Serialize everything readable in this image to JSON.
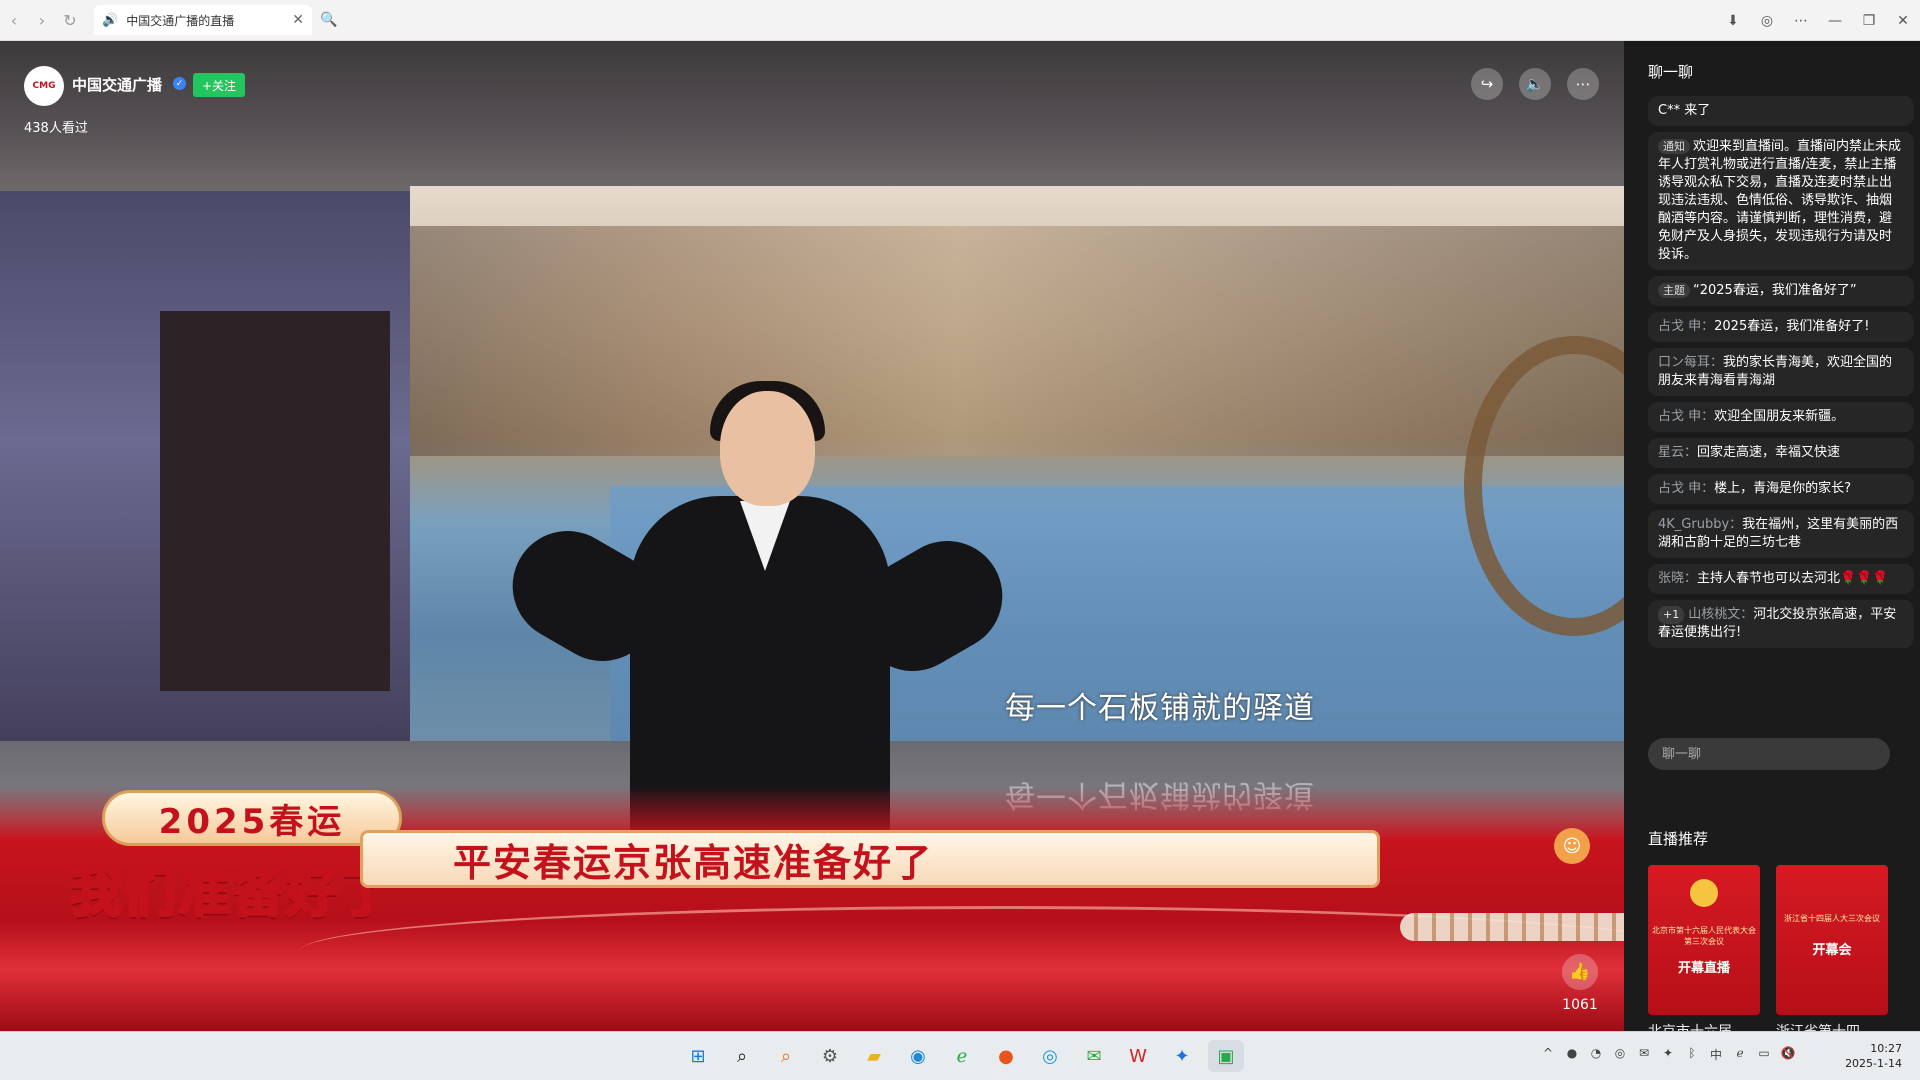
{
  "browser": {
    "tab_title": "中国交通广播的直播",
    "icons": [
      "back-icon",
      "forward-icon",
      "reload-icon",
      "speaker-icon",
      "close-icon",
      "search-icon",
      "download-icon",
      "globe-icon",
      "more-icon",
      "minimize-icon",
      "restore-icon",
      "window-close-icon"
    ]
  },
  "stream": {
    "avatar_text": "CMG",
    "channel_name": "中国交通广播",
    "follow_label": "+关注",
    "viewers": "438人看过",
    "subtitle": "每一个石板铺就的驿道",
    "badge_top": "2025春运",
    "badge_bottom": "我们准备好了",
    "headline": "平安春运京张高速准备好了",
    "like_count": "1061"
  },
  "chat": {
    "title": "聊一聊",
    "messages": [
      {
        "tag": "",
        "user": "",
        "text": "C** 来了"
      },
      {
        "tag": "通知",
        "user": "",
        "text": "欢迎来到直播间。直播间内禁止未成年人打赏礼物或进行直播/连麦，禁止主播诱导观众私下交易，直播及连麦时禁止出现违法违规、色情低俗、诱导欺诈、抽烟酗酒等内容。请谨慎判断，理性消费，避免财产及人身损失，发现违规行为请及时投诉。"
      },
      {
        "tag": "主题",
        "user": "",
        "text": "“2025春运，我们准备好了”"
      },
      {
        "tag": "",
        "user": "占戈 申：",
        "text": "2025春运，我们准备好了!"
      },
      {
        "tag": "",
        "user": "口ン每耳：",
        "text": "我的家长青海美，欢迎全国的朋友来青海看青海湖"
      },
      {
        "tag": "",
        "user": "占戈 申：",
        "text": "欢迎全国朋友来新疆。"
      },
      {
        "tag": "",
        "user": "星云：",
        "text": "回家走高速，幸福又快速"
      },
      {
        "tag": "",
        "user": "占戈 申：",
        "text": "楼上，青海是你的家长?"
      },
      {
        "tag": "",
        "user": "4K_Grubby：",
        "text": "我在福州，这里有美丽的西湖和古韵十足的三坊七巷"
      },
      {
        "tag": "",
        "user": "张晓：",
        "text": "主持人春节也可以去河北🌹🌹🌹"
      },
      {
        "tag": "+1",
        "user": "山核桃文：",
        "text": "河北交投京张高速，平安春运便携出行!"
      }
    ],
    "input_placeholder": "聊一聊"
  },
  "recommend": {
    "title": "直播推荐",
    "cards": [
      {
        "text": "北京市第十六届人民代表大会第三次会议",
        "sub": "开幕直播",
        "caption": "北京市十六届"
      },
      {
        "text": "浙江省十四届人大三次会议",
        "sub": "开幕会",
        "caption": "浙江省第十四"
      }
    ]
  },
  "taskbar": {
    "time": "10:27",
    "date": "2025-1-14"
  },
  "colors": {
    "accent_green": "#22c55e",
    "banner_red": "#c8141e",
    "sidebar_bg": "#1b1b1b"
  }
}
